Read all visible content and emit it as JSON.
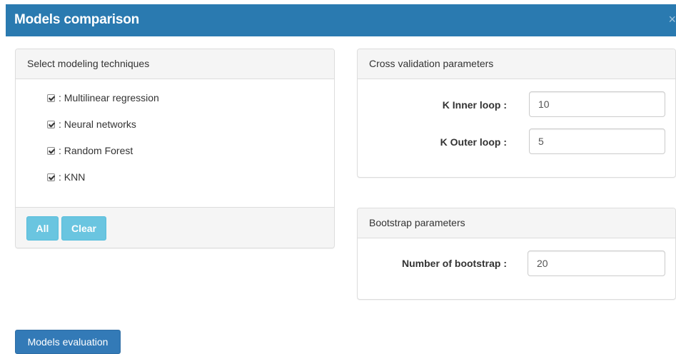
{
  "dialog": {
    "title": "Models comparison",
    "close_glyph": "×"
  },
  "techniques_panel": {
    "heading": "Select modeling techniques",
    "items": [
      {
        "label": ": Multilinear regression",
        "checked": true
      },
      {
        "label": ": Neural networks",
        "checked": true
      },
      {
        "label": ": Random Forest",
        "checked": true
      },
      {
        "label": ": KNN",
        "checked": true
      }
    ],
    "all_label": "All",
    "clear_label": "Clear"
  },
  "cv_panel": {
    "heading": "Cross validation parameters",
    "inner_label": "K Inner loop :",
    "inner_value": "10",
    "outer_label": "K Outer loop :",
    "outer_value": "5"
  },
  "bootstrap_panel": {
    "heading": "Bootstrap parameters",
    "number_label": "Number of bootstrap :",
    "number_value": "20"
  },
  "actions": {
    "evaluate_label": "Models evaluation"
  },
  "colors": {
    "header_bg": "#2a7ab0",
    "info_button": "#5bc0de",
    "primary_button": "#337ab7"
  },
  "icons": {
    "close": "close-icon",
    "checkbox": "checkbox-checked-icon"
  }
}
